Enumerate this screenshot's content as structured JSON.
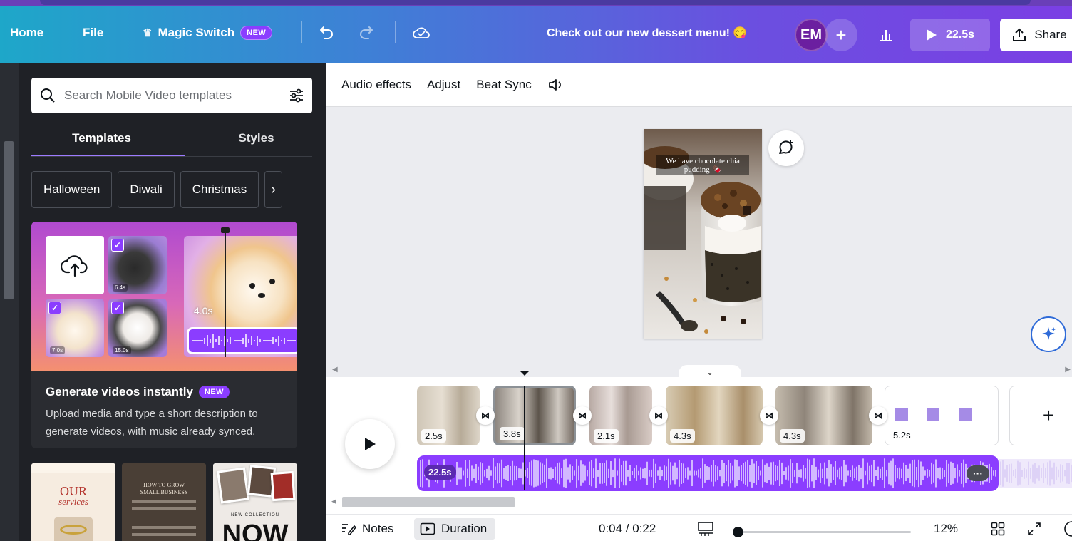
{
  "header": {
    "home": "Home",
    "file": "File",
    "magic_switch": "Magic Switch",
    "magic_badge": "NEW",
    "doc_title": "Check out our new dessert menu! 😋",
    "avatar_initials": "EM",
    "play_duration": "22.5s",
    "share": "Share"
  },
  "sidebar": {
    "search_placeholder": "Search Mobile Video templates",
    "tabs": [
      "Templates",
      "Styles"
    ],
    "active_tab": "Templates",
    "chips": [
      "Halloween",
      "Diwali",
      "Christmas"
    ],
    "promo": {
      "title": "Generate videos instantly",
      "badge": "NEW",
      "description": "Upload media and type a short description to generate videos, with music already synced.",
      "clip_times": [
        "6.4s",
        "7.0s",
        "15.0s"
      ],
      "preview_time": "4.0s"
    },
    "template_thumbs": [
      {
        "line1": "OUR",
        "line2": "services"
      },
      {
        "line1": "HOW TO GROW",
        "line2": "SMALL BUSINESS"
      },
      {
        "line1": "NEW COLLECTION",
        "line2": "NOW"
      }
    ]
  },
  "toolbar": {
    "audio_effects": "Audio effects",
    "adjust": "Adjust",
    "beat_sync": "Beat Sync"
  },
  "canvas": {
    "caption": "We have chocolate chia pudding 🍫"
  },
  "timeline": {
    "clips": [
      {
        "duration": "2.5s"
      },
      {
        "duration": "3.8s"
      },
      {
        "duration": "2.1s"
      },
      {
        "duration": "4.3s"
      },
      {
        "duration": "4.3s"
      },
      {
        "duration": "5.2s"
      }
    ],
    "audio_duration": "22.5s"
  },
  "footer": {
    "notes": "Notes",
    "duration": "Duration",
    "time": "0:04 / 0:22",
    "zoom": "12%"
  },
  "colors": {
    "accent": "#8b3dff",
    "panel_bg": "#1f2126",
    "header_from": "#1ea7c9",
    "header_to": "#7b3fe4"
  }
}
